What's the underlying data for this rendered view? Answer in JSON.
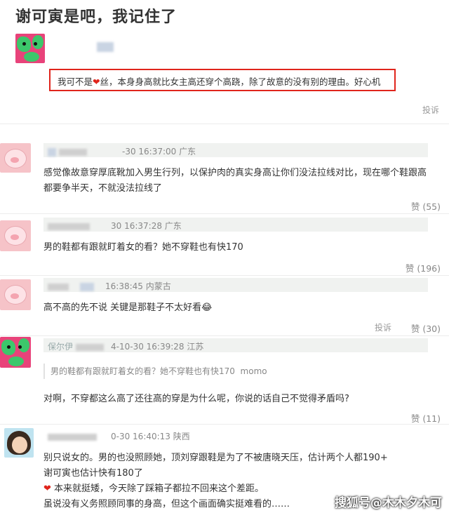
{
  "title": "谢可寅是吧，我记住了",
  "post": {
    "quote_before": "我可不是",
    "quote_heart": "❤",
    "quote_after": "丝，本身身高就比女主高还穿个高跷，除了故意的没有别的理由。好心机",
    "report_label": "投诉"
  },
  "comments": [
    {
      "meta": "-30 16:37:00 广东",
      "text": "感觉像故意穿厚底靴加入男生行列，以保护肉的真实身高让你们没法拉线对比，现在哪个鞋跟高都要争半天，不就没法拉线了",
      "likes": "赞 (55)"
    },
    {
      "meta": "30 16:37:28 广东",
      "text": "男的鞋都有跟就盯着女的看？她不穿鞋也有快170",
      "likes": "赞 (196)"
    },
    {
      "meta": "16:38:45 内蒙古",
      "text": "高不高的先不说 关键是那鞋子不太好看",
      "emoji": "😂",
      "report_label": "投诉",
      "likes": "赞 (30)"
    },
    {
      "meta": "4-10-30 16:39:28 江苏",
      "user_partial": "保尔伊",
      "quoted": "男的鞋都有跟就盯着女的看？她不穿鞋也有快170",
      "quoted_author": "momo",
      "text": "对啊，不穿都这么高了还往高的穿是为什么呢，你说的话自己不觉得矛盾吗?",
      "likes": "赞 (11)"
    },
    {
      "meta": "0-30 16:40:13 陕西",
      "line1": "别只说女的。男的也没照顾她，顶刘穿跟鞋是为了不被唐晓天压，估计两个人都190+",
      "line2": "谢可寅也估计快有180了",
      "line3_heart": "❤",
      "line3": "本来就挺矮，今天除了踩箱子都拉不回来这个差距。",
      "line4": "虽说没有义务照顾同事的身高，但这个画面确实挺难看的……"
    }
  ],
  "watermark": "搜狐号@木木夕木可"
}
